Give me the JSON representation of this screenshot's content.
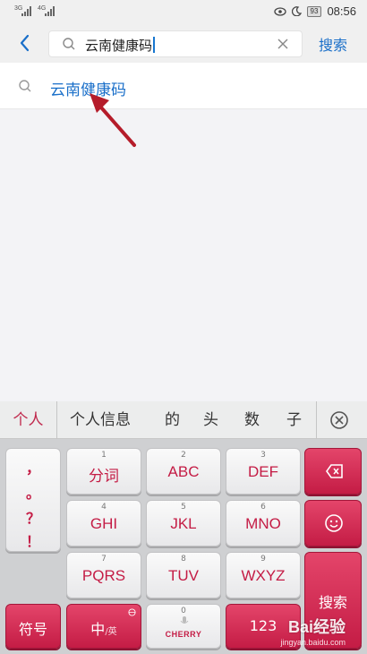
{
  "status_bar": {
    "signal1_label": "3G",
    "signal2_label": "4G",
    "battery": "93",
    "time": "08:56"
  },
  "search": {
    "query": "云南健康码",
    "button_label": "搜索"
  },
  "suggestions": [
    {
      "text": "云南健康码"
    }
  ],
  "keyboard": {
    "candidates": {
      "first": "个人",
      "others": [
        "个人信息",
        "的",
        "头",
        "数",
        "子"
      ]
    },
    "punctuation": [
      "，",
      "。",
      "？",
      "！"
    ],
    "keys": {
      "k1": {
        "num": "1",
        "label": "分词"
      },
      "k2": {
        "num": "2",
        "label": "ABC"
      },
      "k3": {
        "num": "3",
        "label": "DEF"
      },
      "k4": {
        "num": "4",
        "label": "GHI"
      },
      "k5": {
        "num": "5",
        "label": "JKL"
      },
      "k6": {
        "num": "6",
        "label": "MNO"
      },
      "k7": {
        "num": "7",
        "label": "PQRS"
      },
      "k8": {
        "num": "8",
        "label": "TUV"
      },
      "k9": {
        "num": "9",
        "label": "WXYZ"
      },
      "k0": {
        "num": "0",
        "label": "CHERRY"
      }
    },
    "symbols_label": "符号",
    "lang_label": "中",
    "lang_alt": "/英",
    "numbers_label": "123",
    "search_label": "搜索"
  },
  "watermark": {
    "main": "Bai经验",
    "sub": "jingyan.baidu.com"
  }
}
